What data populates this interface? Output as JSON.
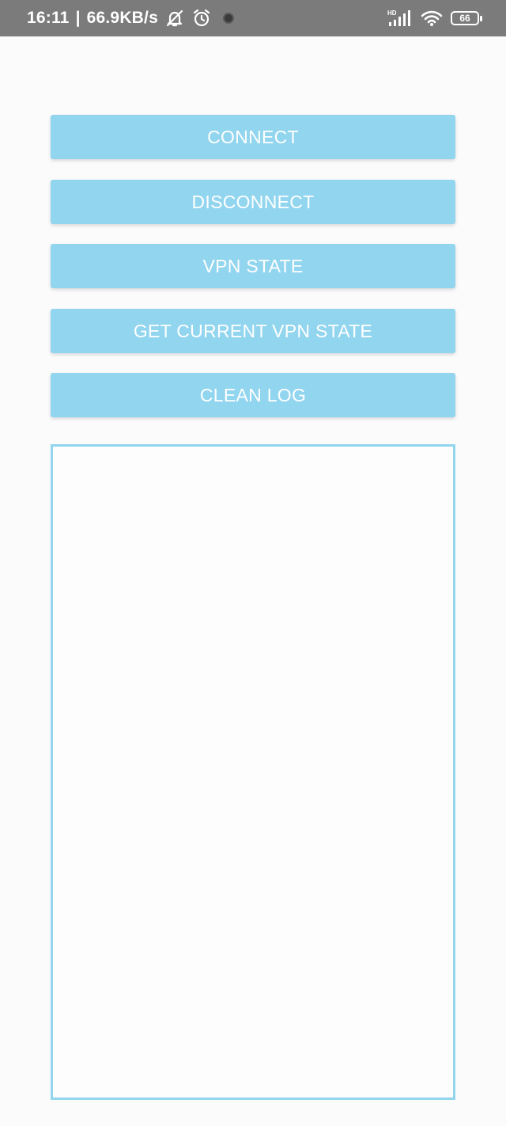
{
  "status_bar": {
    "time": "16:11",
    "separator": "|",
    "network_speed": "66.9KB/s",
    "signal_label": "HD",
    "battery_level": "66",
    "icons": [
      "bell-muted-icon",
      "alarm-icon",
      "camera-dot-icon",
      "signal-icon",
      "wifi-icon",
      "battery-icon"
    ]
  },
  "buttons": {
    "connect": "CONNECT",
    "disconnect": "DISCONNECT",
    "vpn_state": "VPN STATE",
    "get_current_vpn_state": "GET CURRENT VPN STATE",
    "clean_log": "CLEAN LOG"
  },
  "log": {
    "text": ""
  },
  "colors": {
    "status_bar_bg": "#7b7b7b",
    "button_bg": "#92d5ef",
    "button_text": "#ffffff",
    "log_border": "#92d5ef",
    "page_bg": "#fbfbfc"
  }
}
